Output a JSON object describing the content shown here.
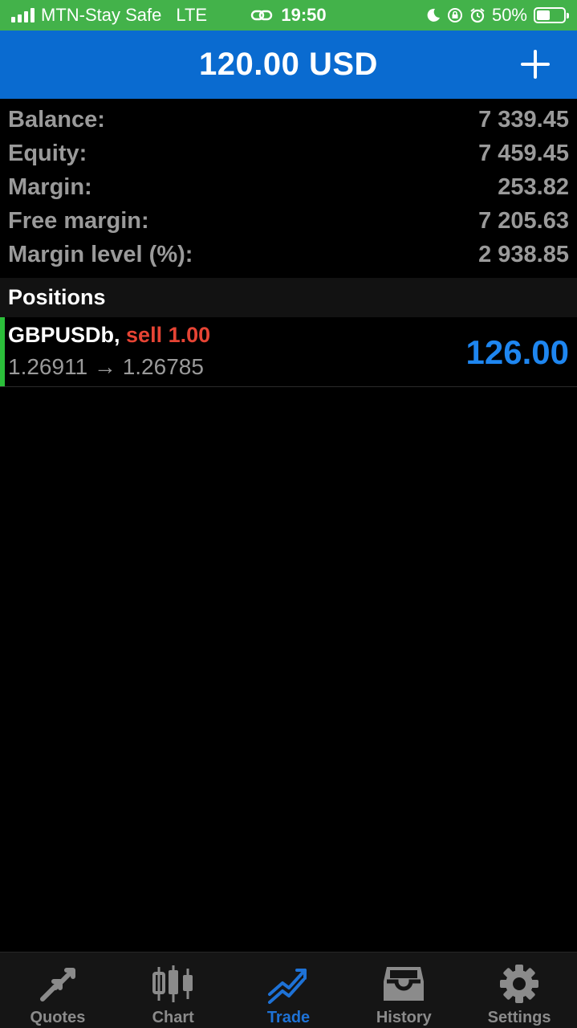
{
  "status_bar": {
    "carrier": "MTN-Stay Safe",
    "network": "LTE",
    "time": "19:50",
    "battery": "50%",
    "battery_level": 0.5,
    "background_color": "#43b24a"
  },
  "header": {
    "title": "120.00 USD",
    "add_icon": "plus-icon",
    "background_color": "#0a6bd0"
  },
  "summary": [
    {
      "label": "Balance:",
      "value": "7 339.45"
    },
    {
      "label": "Equity:",
      "value": "7 459.45"
    },
    {
      "label": "Margin:",
      "value": "253.82"
    },
    {
      "label": "Free margin:",
      "value": "7 205.63"
    },
    {
      "label": "Margin level (%):",
      "value": "2 938.85"
    }
  ],
  "positions": {
    "title": "Positions",
    "items": [
      {
        "symbol": "GBPUSDb,",
        "side": "sell 1.00",
        "prices": "1.26911 → 1.26785",
        "profit": "126.00"
      }
    ]
  },
  "tabs": [
    {
      "label": "Quotes",
      "icon": "quotes-arrows-icon",
      "active": false
    },
    {
      "label": "Chart",
      "icon": "candlestick-chart-icon",
      "active": false
    },
    {
      "label": "Trade",
      "icon": "trade-trend-icon",
      "active": true
    },
    {
      "label": "History",
      "icon": "history-inbox-icon",
      "active": false
    },
    {
      "label": "Settings",
      "icon": "settings-gear-icon",
      "active": false
    }
  ],
  "colors": {
    "accent": "#1e72d6",
    "profit": "#1e86f0",
    "sell": "#e64434",
    "position_marker": "#2bbf3a"
  }
}
